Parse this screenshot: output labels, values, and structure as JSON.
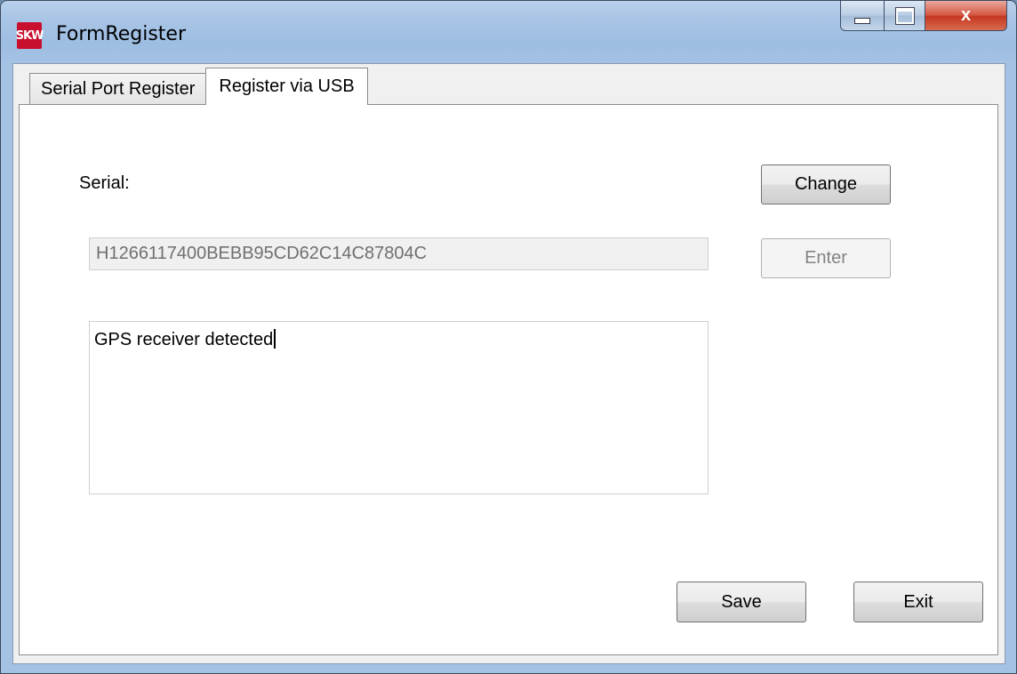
{
  "window": {
    "title": "FormRegister",
    "app_icon_text": "SKW",
    "controls": {
      "close_glyph": "x"
    }
  },
  "tabs": [
    {
      "label": "Serial Port Register",
      "active": false
    },
    {
      "label": "Register via USB",
      "active": true
    }
  ],
  "form": {
    "serial_label": "Serial:",
    "serial_value": "H1266117400BEBB95CD62C14C87804C",
    "log_text": "GPS receiver detected"
  },
  "buttons": {
    "change": "Change",
    "enter": "Enter",
    "save": "Save",
    "exit": "Exit"
  },
  "colors": {
    "close_button": "#c4361f",
    "title_bar": "#a9c5e6"
  }
}
